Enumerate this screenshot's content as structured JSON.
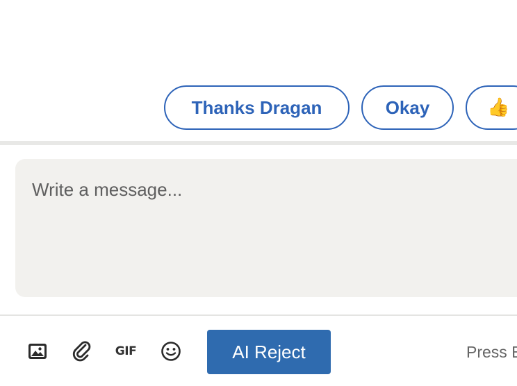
{
  "suggestions": [
    {
      "label": "Thanks Dragan"
    },
    {
      "label": "Okay"
    },
    {
      "label": "👍"
    }
  ],
  "compose": {
    "placeholder": "Write a message..."
  },
  "toolbar": {
    "image_icon": "image-icon",
    "attach_icon": "paperclip-icon",
    "gif_label": "GIF",
    "emoji_icon": "smiley-icon",
    "primary_button_label": "AI Reject",
    "hint_text": "Press E"
  },
  "colors": {
    "accent": "#2d63b8",
    "button": "#2f6baf",
    "compose_bg": "#f2f1ee"
  }
}
